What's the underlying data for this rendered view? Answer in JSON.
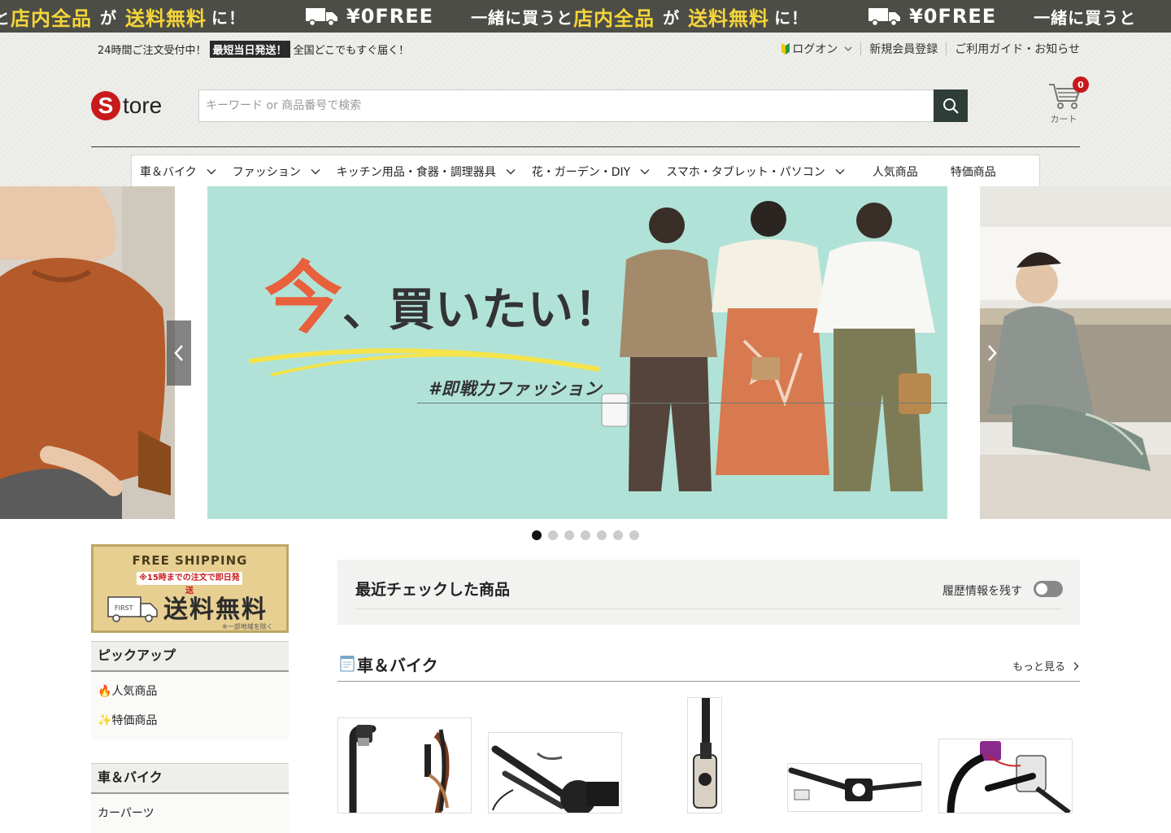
{
  "ticker": {
    "segments": [
      {
        "w": "と",
        "y": "店内全品",
        "w2": "が",
        "y2": "送料無料",
        "w3": "に！"
      },
      {
        "free": "¥0FREE"
      },
      {
        "w": "一緒に買うと",
        "y": "店内全品",
        "w2": "が",
        "y2": "送料無料",
        "w3": "に！"
      },
      {
        "free": "¥0FREE"
      },
      {
        "w": "一緒に買うと"
      }
    ]
  },
  "topbar": {
    "left_prefix": "24時間ご注文受付中！",
    "badge": "最短当日発送！",
    "left_suffix": "全国どこでもすぐ届く！",
    "login": "ログオン",
    "register": "新規会員登録",
    "guide": "ご利用ガイド・お知らせ"
  },
  "logo": {
    "mark": "S",
    "text": "tore"
  },
  "search": {
    "placeholder": "キーワード or 商品番号で検索"
  },
  "cart": {
    "label": "カート",
    "count": "0"
  },
  "categories": [
    {
      "label": "車＆バイク",
      "dropdown": true
    },
    {
      "label": "ファッション",
      "dropdown": true
    },
    {
      "label": "キッチン用品・食器・調理器具",
      "dropdown": true
    },
    {
      "label": "花・ガーデン・DIY",
      "dropdown": true
    },
    {
      "label": "スマホ・タブレット・パソコン",
      "dropdown": true
    },
    {
      "label": "人気商品",
      "dropdown": false
    },
    {
      "label": "特価商品",
      "dropdown": false
    }
  ],
  "hero": {
    "headline_big": "今",
    "headline_rest": "、買いたい！",
    "tag": "#即戦力ファッション",
    "slide_count": 7,
    "active_slide": 1
  },
  "sidebar": {
    "banner": {
      "title": "FREE SHIPPING",
      "sub": "※15時までの注文で即日発送",
      "truck_label": "FIRST",
      "big": "送料無料",
      "note": "※一部地域を除く"
    },
    "pickup": {
      "heading": "ピックアップ",
      "items": [
        "🔥人気商品",
        "✨特価商品"
      ]
    },
    "car": {
      "heading": "車＆バイク",
      "items": [
        "カーパーツ"
      ]
    }
  },
  "recent": {
    "title": "最近チェックした商品",
    "history_label": "履歴情報を残す",
    "history_on": false
  },
  "section": {
    "title": "車＆バイク",
    "more": "もっと見る"
  },
  "colors": {
    "accent": "#c8191d",
    "ticker_bg": "#4d4d47",
    "ticker_highlight": "#f5d63a",
    "search_button": "#2e3d37",
    "hero_bg": "#b1e2d8"
  }
}
